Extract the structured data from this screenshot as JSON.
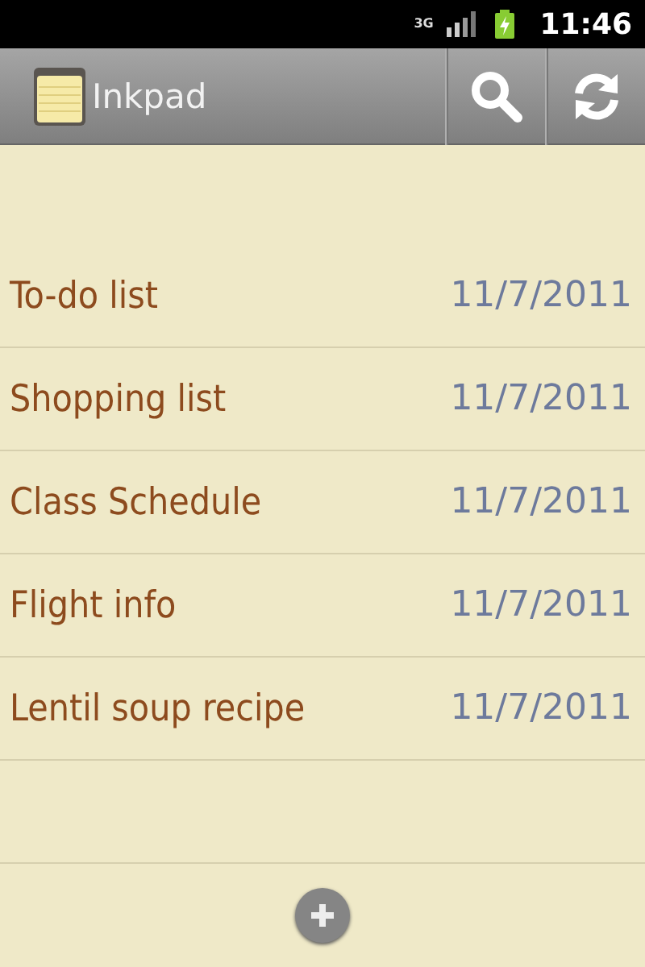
{
  "status_bar": {
    "network": "3G",
    "time": "11:46"
  },
  "action_bar": {
    "title": "Inkpad"
  },
  "notes": [
    {
      "title": "To-do list",
      "date": "11/7/2011"
    },
    {
      "title": "Shopping list",
      "date": "11/7/2011"
    },
    {
      "title": "Class Schedule",
      "date": "11/7/2011"
    },
    {
      "title": "Flight info",
      "date": "11/7/2011"
    },
    {
      "title": "Lentil soup recipe",
      "date": "11/7/2011"
    }
  ]
}
